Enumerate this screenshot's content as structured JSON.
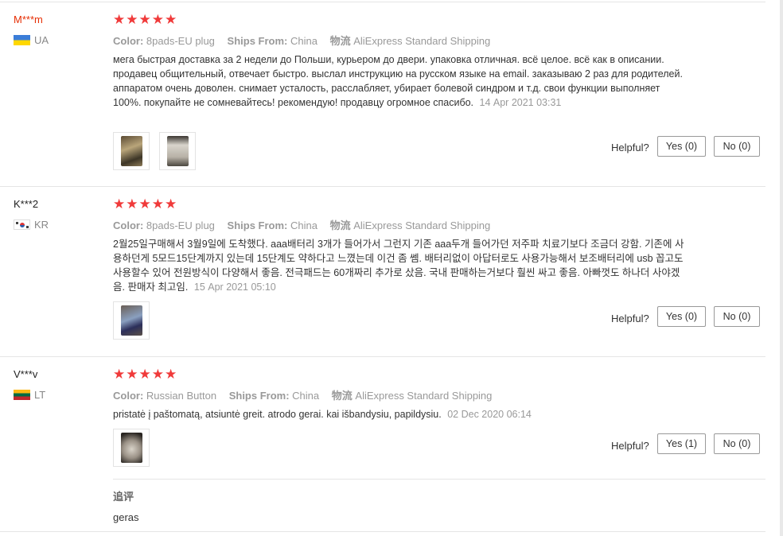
{
  "labels": {
    "color": "Color:",
    "ships_from": "Ships From:",
    "shipping": "物流",
    "helpful": "Helpful?"
  },
  "reviews": [
    {
      "user": "M***m",
      "country": "UA",
      "stars": "★★★★★",
      "rating": 5,
      "color_value": "8pads-EU plug",
      "ships_from_value": "China",
      "shipping_value": "AliExpress Standard Shipping",
      "text": "мега быстрая доставка за 2 недели до Польши, курьером до двери. упаковка отличная. всё целое. всё как в описании. продавец общительный, отвечает быстро. выслал инструкцию на русском языке на email. заказываю 2 раз для родителей. аппаратом очень доволен. снимает усталость, расслабляет, убирает болевой синдром и т.д. свои функции выполняет 100%. покупайте не сомневайтесь! рекомендую! продавцу огромное спасибо.",
      "date": "14 Apr 2021 03:31",
      "yes": "Yes (0)",
      "no": "No (0)"
    },
    {
      "user": "K***2",
      "country": "KR",
      "stars": "★★★★★",
      "rating": 5,
      "color_value": "8pads-EU plug",
      "ships_from_value": "China",
      "shipping_value": "AliExpress Standard Shipping",
      "text": "2월25일구매해서 3월9일에 도착했다. aaa배터리 3개가 들어가서 그런지 기존 aaa두개 들어가던 저주파 치료기보다 조금더 강함. 기존에 사용하던게 5모드15단계까지 있는데 15단계도 약하다고 느꼈는데 이건 좀 쎔. 배터리없이 아답터로도 사용가능해서 보조배터리에 usb 꼽고도 사용할수 있어 전원방식이 다양해서 좋음. 전극패드는 60개짜리 추가로 샀음. 국내 판매하는거보다 훨씬 싸고 좋음. 아빠껏도 하나더 사야겠음. 판매자 최고임.",
      "date": "15 Apr 2021 05:10",
      "yes": "Yes (0)",
      "no": "No (0)"
    },
    {
      "user": "V***v",
      "country": "LT",
      "stars": "★★★★★",
      "rating": 5,
      "color_value": "Russian Button",
      "ships_from_value": "China",
      "shipping_value": "AliExpress Standard Shipping",
      "text": "pristatė į paštomatą, atsiuntė greit. atrodo gerai. kai išbandysiu, papildysiu.",
      "date": "02 Dec 2020 06:14",
      "yes": "Yes (1)",
      "no": "No (0)",
      "additional_title": "追评",
      "additional_text": "geras"
    }
  ]
}
